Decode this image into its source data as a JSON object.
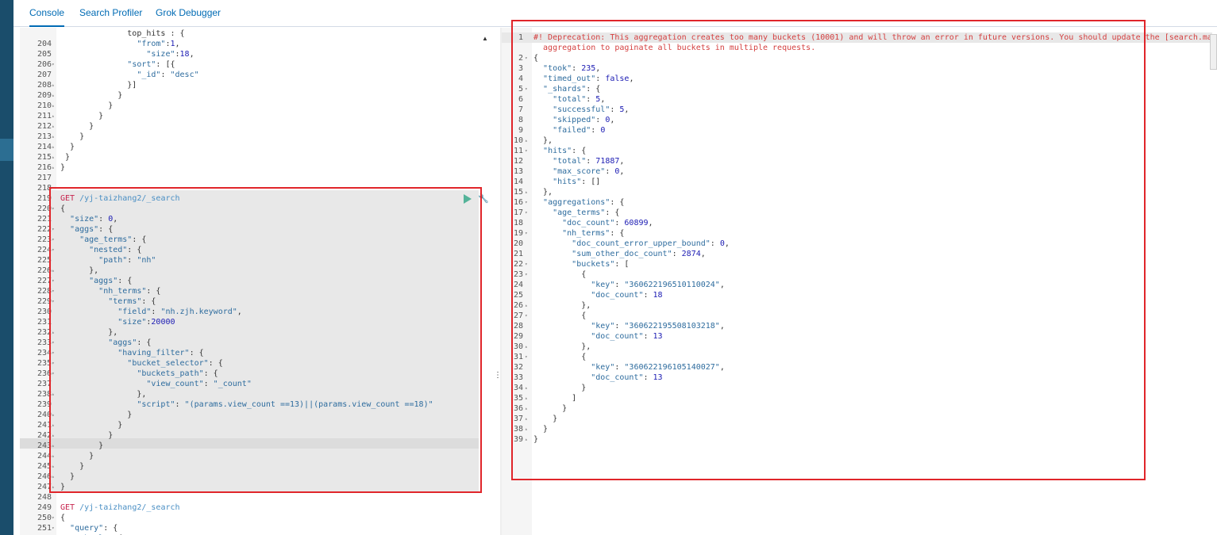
{
  "tabs": [
    {
      "label": "Console",
      "active": true
    },
    {
      "label": "Search Profiler",
      "active": false
    },
    {
      "label": "Grok Debugger",
      "active": false
    }
  ],
  "colors": {
    "accent": "#006bb4",
    "highlight_box": "#e0252a",
    "sidebar": "#1a4d6b",
    "play": "#54b399"
  },
  "icons": {
    "run": "play-icon",
    "settings": "wrench-icon",
    "split": "vertical-ellipsis-icon",
    "scroll_up": "caret-up-icon"
  },
  "left_lines": [
    {
      "n": "",
      "code": "              top_hits : {"
    },
    {
      "n": "204",
      "fold": "",
      "code": "                \"from\":1,"
    },
    {
      "n": "205",
      "fold": "",
      "code": "                  \"size\":18,"
    },
    {
      "n": "206",
      "fold": "▾",
      "code": "              \"sort\": [{"
    },
    {
      "n": "207",
      "fold": "",
      "code": "                \"_id\": \"desc\""
    },
    {
      "n": "208",
      "fold": "▴",
      "code": "              }]"
    },
    {
      "n": "209",
      "fold": "▴",
      "code": "            }"
    },
    {
      "n": "210",
      "fold": "▴",
      "code": "          }"
    },
    {
      "n": "211",
      "fold": "▴",
      "code": "        }"
    },
    {
      "n": "212",
      "fold": "▴",
      "code": "      }"
    },
    {
      "n": "213",
      "fold": "▴",
      "code": "    }"
    },
    {
      "n": "214",
      "fold": "▴",
      "code": "  }"
    },
    {
      "n": "215",
      "fold": "▴",
      "code": " }"
    },
    {
      "n": "216",
      "fold": "▴",
      "code": "}"
    },
    {
      "n": "217",
      "fold": "",
      "code": ""
    },
    {
      "n": "218",
      "fold": "",
      "code": ""
    },
    {
      "n": "219",
      "fold": "",
      "code": "GET /yj-taizhang2/_search"
    },
    {
      "n": "220",
      "fold": "▾",
      "code": "{"
    },
    {
      "n": "221",
      "fold": "",
      "code": "  \"size\": 0,"
    },
    {
      "n": "222",
      "fold": "▾",
      "code": "  \"aggs\": {"
    },
    {
      "n": "223",
      "fold": "▾",
      "code": "    \"age_terms\": {"
    },
    {
      "n": "224",
      "fold": "▾",
      "code": "      \"nested\": {"
    },
    {
      "n": "225",
      "fold": "",
      "code": "        \"path\": \"nh\""
    },
    {
      "n": "226",
      "fold": "▴",
      "code": "      },"
    },
    {
      "n": "227",
      "fold": "▾",
      "code": "      \"aggs\": {"
    },
    {
      "n": "228",
      "fold": "▾",
      "code": "        \"nh_terms\": {"
    },
    {
      "n": "229",
      "fold": "▾",
      "code": "          \"terms\": {"
    },
    {
      "n": "230",
      "fold": "",
      "code": "            \"field\": \"nh.zjh.keyword\","
    },
    {
      "n": "231",
      "fold": "",
      "code": "            \"size\":20000"
    },
    {
      "n": "232",
      "fold": "▴",
      "code": "          },"
    },
    {
      "n": "233",
      "fold": "▾",
      "code": "          \"aggs\": {"
    },
    {
      "n": "234",
      "fold": "▾",
      "code": "            \"having_filter\": {"
    },
    {
      "n": "235",
      "fold": "▾",
      "code": "              \"bucket_selector\": {"
    },
    {
      "n": "236",
      "fold": "▾",
      "code": "                \"buckets_path\": {"
    },
    {
      "n": "237",
      "fold": "",
      "code": "                  \"view_count\": \"_count\""
    },
    {
      "n": "238",
      "fold": "▴",
      "code": "                },"
    },
    {
      "n": "239",
      "fold": "",
      "code": "                \"script\": \"(params.view_count ==13)||(params.view_count ==18)\""
    },
    {
      "n": "240",
      "fold": "▴",
      "code": "              }"
    },
    {
      "n": "241",
      "fold": "▴",
      "code": "            }"
    },
    {
      "n": "242",
      "fold": "▴",
      "code": "          }"
    },
    {
      "n": "243",
      "fold": "▴",
      "code": "        }"
    },
    {
      "n": "244",
      "fold": "▴",
      "code": "      }"
    },
    {
      "n": "245",
      "fold": "▴",
      "code": "    }"
    },
    {
      "n": "246",
      "fold": "▴",
      "code": "  }"
    },
    {
      "n": "247",
      "fold": "▴",
      "code": "}"
    },
    {
      "n": "248",
      "fold": "",
      "code": ""
    },
    {
      "n": "249",
      "fold": "",
      "code": "GET /yj-taizhang2/_search"
    },
    {
      "n": "250",
      "fold": "▾",
      "code": "{"
    },
    {
      "n": "251",
      "fold": "▾",
      "code": "  \"query\": {"
    },
    {
      "n": "252",
      "fold": "▾",
      "code": "    \"bool\": {"
    }
  ],
  "right_lines": [
    {
      "n": "1",
      "fold": "",
      "code": "#! Deprecation: This aggregation creates too many buckets (10001) and will throw an error in future versions. You should update the [search.max_buckets] cluster setting or use the [composite] aggregation to paginate all buckets in multiple requests.",
      "warn": true
    },
    {
      "n": "",
      "fold": "",
      "code": "  aggregation to paginate all buckets in multiple requests.",
      "warn": true
    },
    {
      "n": "2",
      "fold": "▾",
      "code": "{"
    },
    {
      "n": "3",
      "fold": "",
      "code": "  \"took\": 235,"
    },
    {
      "n": "4",
      "fold": "",
      "code": "  \"timed_out\": false,"
    },
    {
      "n": "5",
      "fold": "▾",
      "code": "  \"_shards\": {"
    },
    {
      "n": "6",
      "fold": "",
      "code": "    \"total\": 5,"
    },
    {
      "n": "7",
      "fold": "",
      "code": "    \"successful\": 5,"
    },
    {
      "n": "8",
      "fold": "",
      "code": "    \"skipped\": 0,"
    },
    {
      "n": "9",
      "fold": "",
      "code": "    \"failed\": 0"
    },
    {
      "n": "10",
      "fold": "▴",
      "code": "  },"
    },
    {
      "n": "11",
      "fold": "▾",
      "code": "  \"hits\": {"
    },
    {
      "n": "12",
      "fold": "",
      "code": "    \"total\": 71887,"
    },
    {
      "n": "13",
      "fold": "",
      "code": "    \"max_score\": 0,"
    },
    {
      "n": "14",
      "fold": "",
      "code": "    \"hits\": []"
    },
    {
      "n": "15",
      "fold": "▴",
      "code": "  },"
    },
    {
      "n": "16",
      "fold": "▾",
      "code": "  \"aggregations\": {"
    },
    {
      "n": "17",
      "fold": "▾",
      "code": "    \"age_terms\": {"
    },
    {
      "n": "18",
      "fold": "",
      "code": "      \"doc_count\": 60899,"
    },
    {
      "n": "19",
      "fold": "▾",
      "code": "      \"nh_terms\": {"
    },
    {
      "n": "20",
      "fold": "",
      "code": "        \"doc_count_error_upper_bound\": 0,"
    },
    {
      "n": "21",
      "fold": "",
      "code": "        \"sum_other_doc_count\": 2874,"
    },
    {
      "n": "22",
      "fold": "▾",
      "code": "        \"buckets\": ["
    },
    {
      "n": "23",
      "fold": "▾",
      "code": "          {"
    },
    {
      "n": "24",
      "fold": "",
      "code": "            \"key\": \"360622196510110024\","
    },
    {
      "n": "25",
      "fold": "",
      "code": "            \"doc_count\": 18"
    },
    {
      "n": "26",
      "fold": "▴",
      "code": "          },"
    },
    {
      "n": "27",
      "fold": "▾",
      "code": "          {"
    },
    {
      "n": "28",
      "fold": "",
      "code": "            \"key\": \"360622195508103218\","
    },
    {
      "n": "29",
      "fold": "",
      "code": "            \"doc_count\": 13"
    },
    {
      "n": "30",
      "fold": "▴",
      "code": "          },"
    },
    {
      "n": "31",
      "fold": "▾",
      "code": "          {"
    },
    {
      "n": "32",
      "fold": "",
      "code": "            \"key\": \"360622196105140027\","
    },
    {
      "n": "33",
      "fold": "",
      "code": "            \"doc_count\": 13"
    },
    {
      "n": "34",
      "fold": "▴",
      "code": "          }"
    },
    {
      "n": "35",
      "fold": "▴",
      "code": "        ]"
    },
    {
      "n": "36",
      "fold": "▴",
      "code": "      }"
    },
    {
      "n": "37",
      "fold": "▴",
      "code": "    }"
    },
    {
      "n": "38",
      "fold": "▴",
      "code": "  }"
    },
    {
      "n": "39",
      "fold": "▴",
      "code": "}"
    }
  ]
}
